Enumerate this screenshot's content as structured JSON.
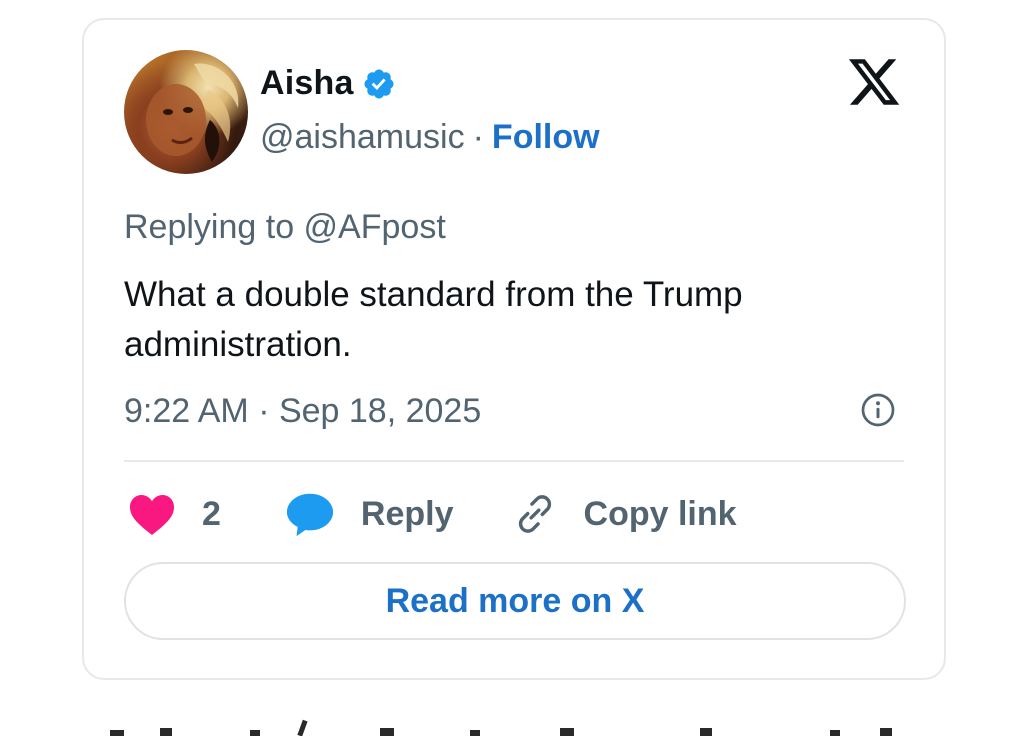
{
  "tweet": {
    "author_name": "Aisha",
    "handle": "@aishamusic",
    "separator": "·",
    "follow_label": "Follow",
    "replying_to": "Replying to @AFpost",
    "text": "What a double standard from the Trump administration.",
    "timestamp": "9:22 AM · Sep 18, 2025",
    "like_count": "2",
    "reply_label": "Reply",
    "copy_link_label": "Copy link",
    "read_more_label": "Read more on X"
  },
  "icons": {
    "verified": "verified-badge-icon",
    "brand": "x-logo-icon",
    "info": "info-icon",
    "like": "heart-icon",
    "reply": "reply-bubble-icon",
    "link": "link-icon"
  },
  "colors": {
    "accent_blue": "#1d70c8",
    "verified_blue": "#1d9bf0",
    "heart_pink": "#f91880",
    "muted_text": "#536471",
    "text": "#0f1419",
    "border": "#e6e9ec"
  }
}
